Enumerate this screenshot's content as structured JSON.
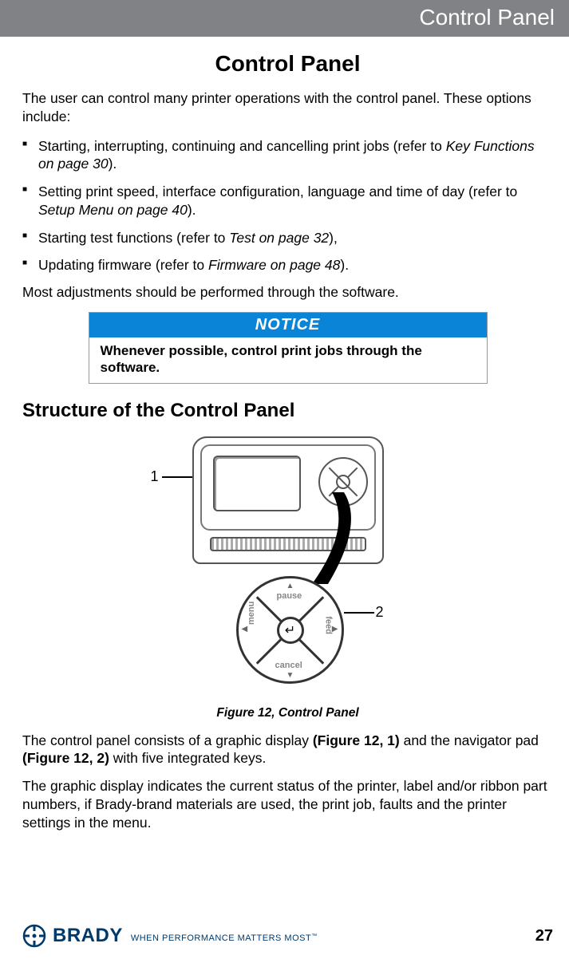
{
  "header": {
    "section": "Control Panel"
  },
  "title": "Control Panel",
  "intro": "The user can control many printer operations with the control panel. These options include:",
  "bullets": [
    {
      "pre": "Starting, interrupting, continuing and cancelling print jobs (refer to ",
      "ref": "Key Functions on page 30",
      "post": ")."
    },
    {
      "pre": "Setting print speed, interface configuration, language and time of day (refer to ",
      "ref": "Setup Menu on page 40",
      "post": ")."
    },
    {
      "pre": "Starting test functions (refer to ",
      "ref": "Test on page 32",
      "post": "),"
    },
    {
      "pre": "Updating firmware (refer to ",
      "ref": "Firmware on page 48",
      "post": ")."
    }
  ],
  "software_note": "Most adjustments should be performed through the software.",
  "notice": {
    "head": "NOTICE",
    "body": "Whenever possible, control print jobs through the software."
  },
  "section_title": "Structure of the Control Panel",
  "figure": {
    "callout1": "1",
    "callout2": "2",
    "caption": "Figure 12, Control Panel",
    "pad_labels": {
      "top": "pause",
      "bottom": "cancel",
      "left": "menu",
      "right": "feed"
    },
    "enter_glyph": "↵"
  },
  "para1": {
    "a": "The control panel consists of a graphic display ",
    "b": "(Figure 12, 1)",
    "c": " and the navigator pad ",
    "d": "(Figure 12, 2)",
    "e": " with five integrated keys."
  },
  "para2": "The graphic display indicates the current status of the printer, label and/or ribbon part numbers, if Brady-brand materials are used, the print job, faults and the printer settings in the menu.",
  "footer": {
    "brand": "BRADY",
    "tagline": "WHEN PERFORMANCE MATTERS MOST",
    "tm": "™",
    "page": "27"
  }
}
